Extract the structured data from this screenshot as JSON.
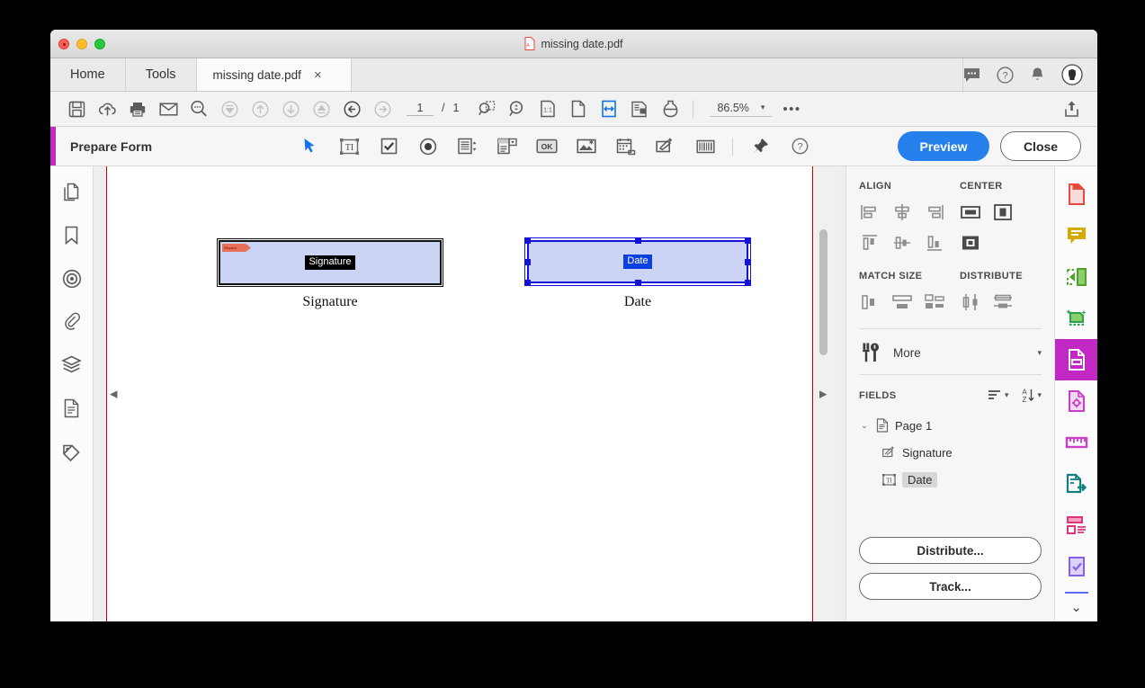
{
  "window": {
    "title": "missing date.pdf",
    "traffic_lights": [
      "close",
      "minimize",
      "maximize"
    ]
  },
  "tabs": {
    "nav": [
      {
        "label": "Home",
        "name": "tab-home"
      },
      {
        "label": "Tools",
        "name": "tab-tools"
      }
    ],
    "document": {
      "label": "missing date.pdf",
      "close": "×"
    }
  },
  "toolbar": {
    "left_icons": [
      "save-icon",
      "cloud-upload-icon",
      "print-icon",
      "email-icon",
      "search-icon",
      "first-page-icon",
      "previous-page-icon",
      "next-page-icon",
      "last-page-icon",
      "back-icon",
      "forward-icon"
    ],
    "page_current": "1",
    "page_separator": "/",
    "page_total": "1",
    "right_icons": [
      "zoom-selection-icon",
      "marquee-zoom-icon",
      "actual-size-icon",
      "fit-page-icon",
      "fit-width-icon",
      "read-mode-icon",
      "ink-icon"
    ],
    "zoom_level": "86.5%",
    "overflow": "•••",
    "share_icon": "share-icon"
  },
  "tab_actions": [
    "comment-icon",
    "help-icon",
    "notification-icon",
    "avatar-icon"
  ],
  "prepare_form": {
    "title": "Prepare Form",
    "accent_color": "#c229c2",
    "tools": [
      "select-pointer-icon",
      "text-field-icon",
      "checkbox-icon",
      "radio-button-icon",
      "list-box-icon",
      "dropdown-icon",
      "button-ok-icon",
      "image-field-icon",
      "date-field-icon",
      "signature-field-icon",
      "barcode-icon"
    ],
    "tools_right": [
      "pin-icon",
      "help-icon"
    ],
    "preview_label": "Preview",
    "close_label": "Close",
    "preview_color": "#2680eb"
  },
  "left_rail": [
    "page-thumbnails-icon",
    "bookmarks-icon",
    "destinations-icon",
    "attachments-icon",
    "layers-icon",
    "content-icon",
    "tags-icon"
  ],
  "document": {
    "fields": [
      {
        "name": "Signature",
        "tag_label": "Signature",
        "caption": "Signature",
        "required_flag": "Required",
        "selected": false,
        "fill_color": "#ccd4f5",
        "border_color": "#111111"
      },
      {
        "name": "Date",
        "tag_label": "Date",
        "caption": "Date",
        "selected": true,
        "fill_color": "#ccd4f5",
        "border_color": "#1212d8"
      }
    ],
    "collapse_left": "◀",
    "collapse_right": "▶"
  },
  "right_panel": {
    "align": {
      "title": "ALIGN",
      "icons": [
        "align-left-icon",
        "align-horizontal-center-icon",
        "align-right-icon",
        "align-top-icon",
        "align-vertical-center-icon",
        "align-bottom-icon"
      ]
    },
    "center": {
      "title": "CENTER",
      "icons": [
        "center-horizontally-icon",
        "center-vertically-icon",
        "center-both-icon"
      ]
    },
    "match_size": {
      "title": "MATCH SIZE",
      "icons": [
        "match-width-icon",
        "match-height-icon",
        "match-both-icon"
      ]
    },
    "distribute": {
      "title": "DISTRIBUTE",
      "icons": [
        "distribute-vertically-icon",
        "distribute-horizontally-icon"
      ]
    },
    "more": {
      "label": "More",
      "icon": "tools-icon",
      "caret": "▾"
    },
    "fields": {
      "title": "FIELDS",
      "sort_order_icon": "sort-order-icon",
      "sort_alpha_icon": "sort-alphabetical-icon",
      "tree": {
        "page_label": "Page 1",
        "expand_caret": "⌄",
        "items": [
          {
            "label": "Signature",
            "icon": "signature-field-icon",
            "selected": false
          },
          {
            "label": "Date",
            "icon": "text-field-icon",
            "selected": true
          }
        ]
      }
    },
    "distribute_button": "Distribute...",
    "track_button": "Track..."
  },
  "tool_rail": {
    "items": [
      {
        "name": "create-pdf-icon",
        "color": "#e8493f"
      },
      {
        "name": "comment-icon",
        "color": "#d4aa00"
      },
      {
        "name": "export-pdf-icon",
        "color": "#62b543"
      },
      {
        "name": "enhance-scans-icon",
        "color": "#2ba24c"
      },
      {
        "name": "prepare-form-icon",
        "color": "#ffffff",
        "active": true
      },
      {
        "name": "edit-pdf-icon",
        "color": "#c93fc9"
      },
      {
        "name": "measure-icon",
        "color": "#c93fc9"
      },
      {
        "name": "send-for-signature-icon",
        "color": "#13807f"
      },
      {
        "name": "organize-pages-icon",
        "color": "#e0347a"
      },
      {
        "name": "certificates-icon",
        "color": "#8561e8"
      }
    ],
    "more_caret": "⌄"
  }
}
